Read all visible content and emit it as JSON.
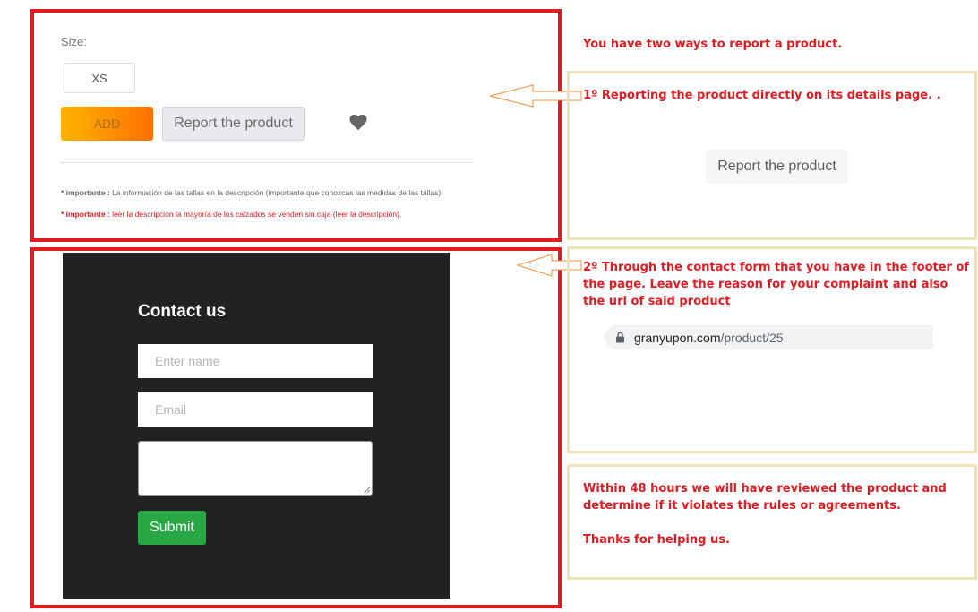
{
  "product": {
    "size_label": "Size:",
    "size_option": "XS",
    "add_label": "ADD",
    "report_label": "Report the product",
    "note1_prefix": "* importante :",
    "note1_text": " La información de las tallas en la descripción (importante que conozcas las medidas de las tallas).",
    "note2_prefix": "* importante :",
    "note2_text": " leer la descripción la mayoría de los calzados se venden sin caja (leer la descripción)."
  },
  "contact": {
    "title": "Contact us",
    "name_placeholder": "Enter name",
    "email_placeholder": "Email",
    "submit_label": "Submit"
  },
  "annotations": {
    "heading": "You have two ways to report a product.",
    "step1": "1º   Reporting the product directly on its details page. .",
    "sample_report_label": "Report the product",
    "step2": "2º Through the contact form that you have in the footer of the page. Leave the reason for your complaint and also the url of said product",
    "url_domain": "granyupon.com",
    "url_path": "/product/25",
    "final_line1": "Within 48 hours we will have reviewed the product and determine if it violates the rules or agreements.",
    "final_line2": "Thanks for helping us."
  },
  "colors": {
    "frame_red": "#e01b22",
    "frame_beige": "#ede3b6",
    "submit_green": "#28a745",
    "footer_dark": "#222222"
  }
}
